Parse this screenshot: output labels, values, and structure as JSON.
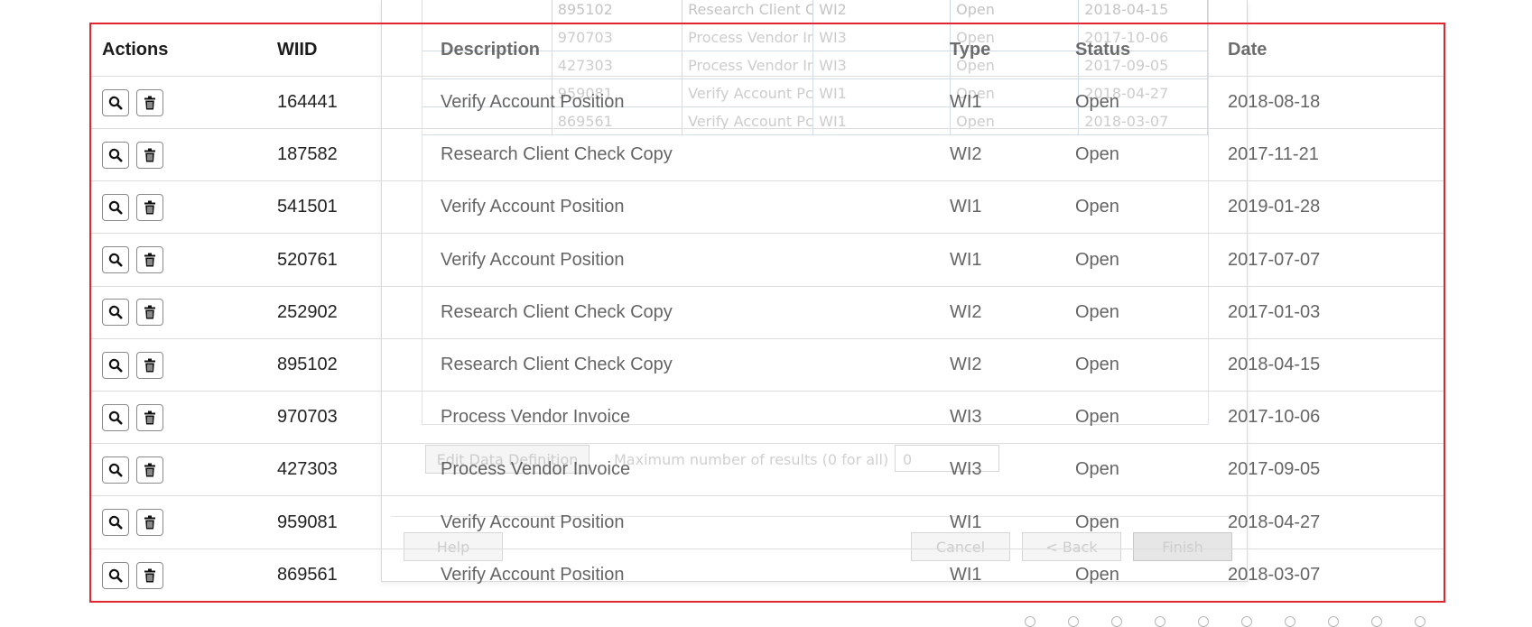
{
  "ghost": {
    "rows": [
      {
        "id": "895102",
        "desc": "Research Client C",
        "type": "WI2",
        "status": "Open",
        "date": "2018-04-15"
      },
      {
        "id": "970703",
        "desc": "Process Vendor In",
        "type": "WI3",
        "status": "Open",
        "date": "2017-10-06"
      },
      {
        "id": "427303",
        "desc": "Process Vendor In",
        "type": "WI3",
        "status": "Open",
        "date": "2017-09-05"
      },
      {
        "id": "959081",
        "desc": "Verify Account Pc",
        "type": "WI1",
        "status": "Open",
        "date": "2018-04-27"
      },
      {
        "id": "869561",
        "desc": "Verify Account Pc",
        "type": "WI1",
        "status": "Open",
        "date": "2018-03-07"
      }
    ],
    "edit_data_definition_label": "Edit Data Definition",
    "max_results_label": "Maximum number of results (0 for all)",
    "max_results_value": "0",
    "help_label": "Help",
    "cancel_label": "Cancel",
    "back_label": "< Back",
    "finish_label": "Finish"
  },
  "table": {
    "headers": {
      "actions": "Actions",
      "wiid": "WIID",
      "description": "Description",
      "type": "Type",
      "status": "Status",
      "date": "Date"
    },
    "rows": [
      {
        "wiid": "164441",
        "description": "Verify Account Position",
        "type": "WI1",
        "status": "Open",
        "date": "2018-08-18"
      },
      {
        "wiid": "187582",
        "description": "Research Client Check Copy",
        "type": "WI2",
        "status": "Open",
        "date": "2017-11-21"
      },
      {
        "wiid": "541501",
        "description": "Verify Account Position",
        "type": "WI1",
        "status": "Open",
        "date": "2019-01-28"
      },
      {
        "wiid": "520761",
        "description": "Verify Account Position",
        "type": "WI1",
        "status": "Open",
        "date": "2017-07-07"
      },
      {
        "wiid": "252902",
        "description": "Research Client Check Copy",
        "type": "WI2",
        "status": "Open",
        "date": "2017-01-03"
      },
      {
        "wiid": "895102",
        "description": "Research Client Check Copy",
        "type": "WI2",
        "status": "Open",
        "date": "2018-04-15"
      },
      {
        "wiid": "970703",
        "description": "Process Vendor Invoice",
        "type": "WI3",
        "status": "Open",
        "date": "2017-10-06"
      },
      {
        "wiid": "427303",
        "description": "Process Vendor Invoice",
        "type": "WI3",
        "status": "Open",
        "date": "2017-09-05"
      },
      {
        "wiid": "959081",
        "description": "Verify Account Position",
        "type": "WI1",
        "status": "Open",
        "date": "2018-04-27"
      },
      {
        "wiid": "869561",
        "description": "Verify Account Position",
        "type": "WI1",
        "status": "Open",
        "date": "2018-03-07"
      }
    ],
    "row_icons": [
      "search-icon",
      "trash-icon"
    ],
    "highlight_color": "#e0262f"
  },
  "pagination": {
    "dot_count": 10
  }
}
